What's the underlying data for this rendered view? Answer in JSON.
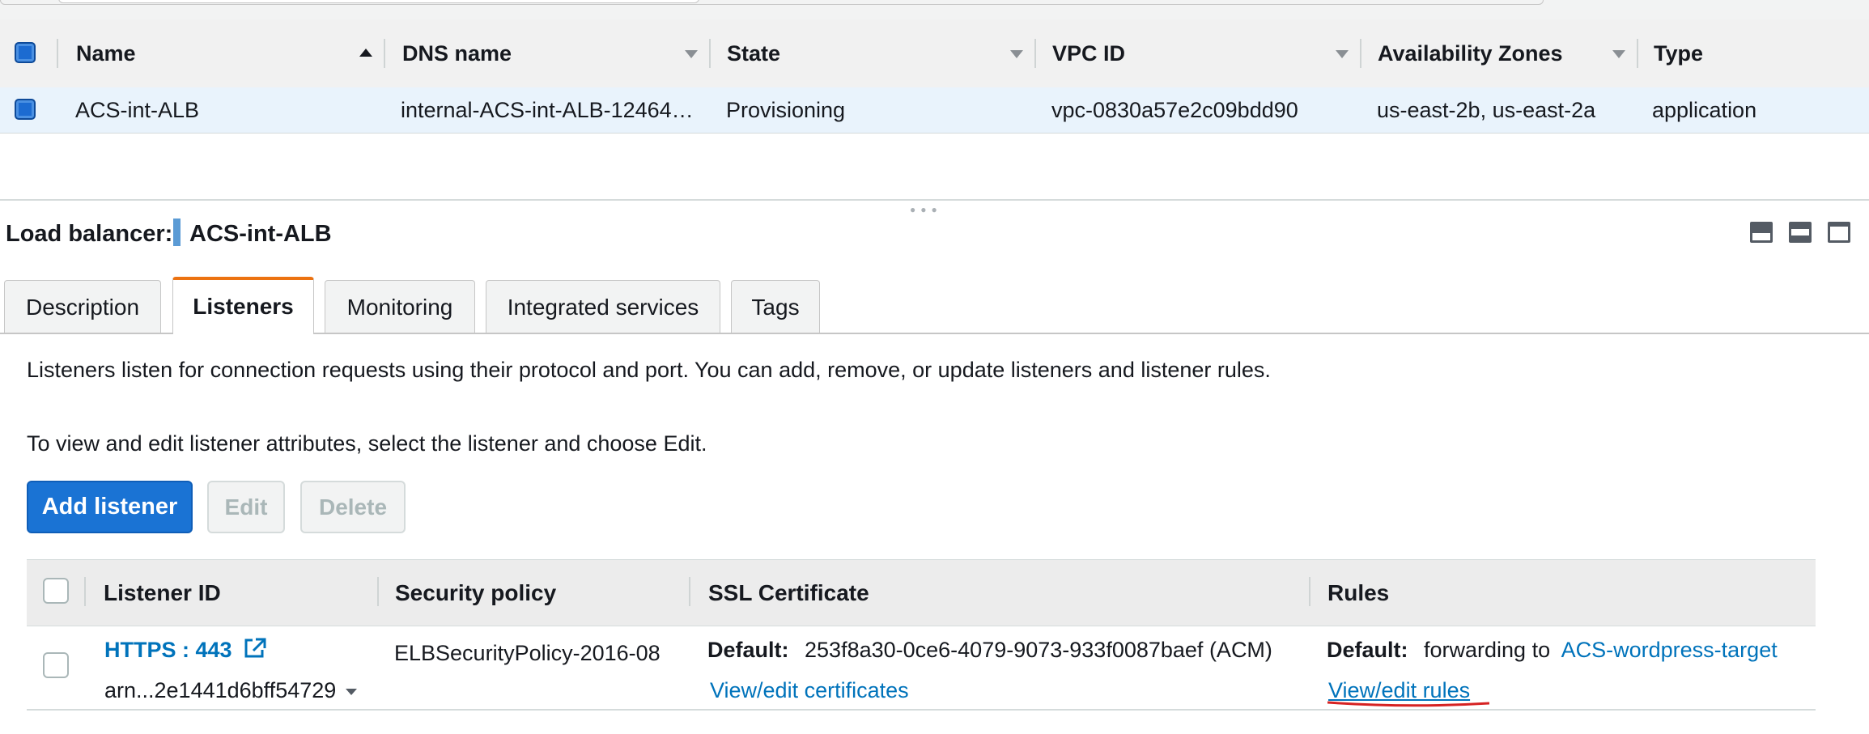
{
  "load_balancers_table": {
    "columns": [
      "Name",
      "DNS name",
      "State",
      "VPC ID",
      "Availability Zones",
      "Type"
    ],
    "rows": [
      {
        "name": "ACS-int-ALB",
        "dns_name": "internal-ACS-int-ALB-12464…",
        "state": "Provisioning",
        "vpc_id": "vpc-0830a57e2c09bdd90",
        "availability_zones": "us-east-2b, us-east-2a",
        "type": "application"
      }
    ]
  },
  "details": {
    "label": "Load balancer:",
    "name": "ACS-int-ALB",
    "tabs": [
      "Description",
      "Listeners",
      "Monitoring",
      "Integrated services",
      "Tags"
    ],
    "active_tab": "Listeners",
    "description_line1": "Listeners listen for connection requests using their protocol and port. You can add, remove, or update listeners and listener rules.",
    "description_line2": "To view and edit listener attributes, select the listener and choose Edit.",
    "buttons": {
      "add": "Add listener",
      "edit": "Edit",
      "delete": "Delete"
    }
  },
  "listeners_table": {
    "columns": [
      "Listener ID",
      "Security policy",
      "SSL Certificate",
      "Rules"
    ],
    "rows": [
      {
        "listener_id": "HTTPS : 443",
        "arn": "arn...2e1441d6bff54729",
        "security_policy": "ELBSecurityPolicy-2016-08",
        "ssl_default_label": "Default:",
        "ssl_certificate": "253f8a30-0ce6-4079-9073-933f0087baef (ACM)",
        "ssl_link": "View/edit certificates",
        "rules_default_label": "Default:",
        "rules_text": "forwarding to",
        "rules_target": "ACS-wordpress-target",
        "rules_link": "View/edit rules"
      }
    ]
  },
  "colors": {
    "accent_tab": "#ec7211",
    "primary_button": "#1a73d4",
    "link": "#0073bb",
    "selected_row": "#e9f3fc",
    "annotation": "#d62222"
  },
  "icons": [
    "sort-asc-icon",
    "sort-desc-icon",
    "external-link-icon",
    "caret-down-icon",
    "panel-bottom-icon",
    "panel-half-icon",
    "panel-full-icon"
  ]
}
